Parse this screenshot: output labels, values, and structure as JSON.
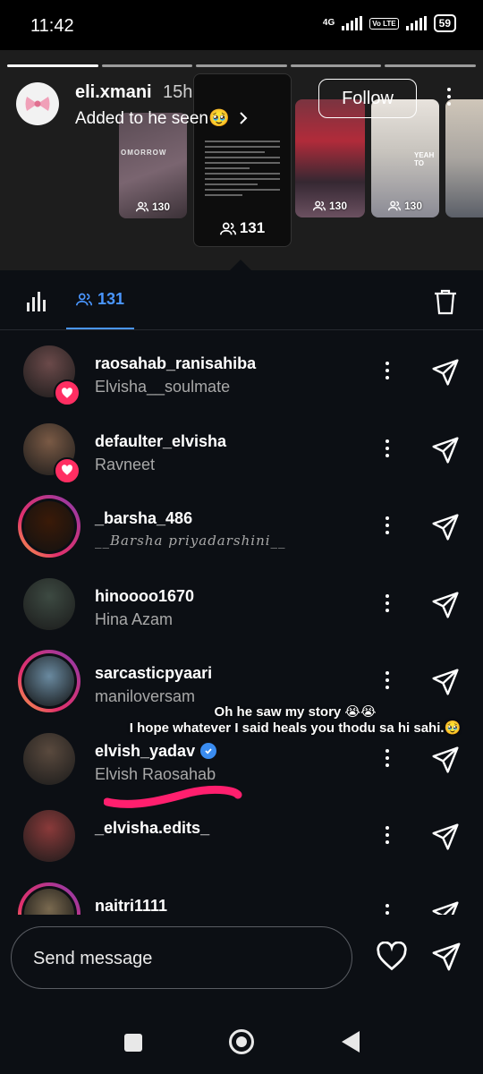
{
  "status_bar": {
    "time": "11:42",
    "network": "4G",
    "volte": "Vo LTE",
    "battery": "59"
  },
  "story": {
    "username": "eli.xmani",
    "time_ago": "15h",
    "caption": "Added to he seen🥹",
    "follow_label": "Follow",
    "thumbnails": [
      {
        "views": "130",
        "text": "OMORROW"
      },
      {
        "views": "131"
      },
      {
        "views": "130"
      },
      {
        "views": "130",
        "text": "YEAH TO"
      },
      {
        "views": ""
      }
    ]
  },
  "toolbar": {
    "viewers_count": "131"
  },
  "viewers": [
    {
      "username": "raosahab_ranisahiba",
      "name": "Elvisha__soulmate",
      "liked": true,
      "ring": false,
      "avatar_color": "#6b4a4a"
    },
    {
      "username": "defaulter_elvisha",
      "name": "Ravneet",
      "liked": true,
      "ring": false,
      "avatar_color": "#7a5a45"
    },
    {
      "username": "_barsha_486",
      "name": "__Barsha priyadarshini__",
      "liked": false,
      "ring": true,
      "avatar_color": "#3a1a08"
    },
    {
      "username": "hinoooo1670",
      "name": "Hina Azam",
      "liked": false,
      "ring": false,
      "avatar_color": "#3d4a42"
    },
    {
      "username": "sarcasticpyaari",
      "name": "maniloversam",
      "liked": false,
      "ring": true,
      "avatar_color": "#6a8aa0"
    },
    {
      "username": "elvish_yadav",
      "name": "Elvish Raosahab",
      "liked": false,
      "ring": false,
      "verified": true,
      "avatar_color": "#5a4a3e"
    },
    {
      "username": "_elvisha.edits_",
      "name": "",
      "liked": false,
      "ring": false,
      "avatar_color": "#8a3a3a"
    },
    {
      "username": "naitri1111",
      "name": "",
      "liked": false,
      "ring": true,
      "avatar_color": "#7a6a50"
    }
  ],
  "overlay": {
    "line1": "Oh he saw my story 😭😭",
    "line2": "I hope whatever I said heals you thodu sa hi sahi.🥹"
  },
  "composer": {
    "placeholder": "Send message"
  },
  "colors": {
    "accent": "#4a96ff",
    "like": "#ff2e62",
    "scribble": "#ff1f6e",
    "background": "#0c0f14"
  }
}
